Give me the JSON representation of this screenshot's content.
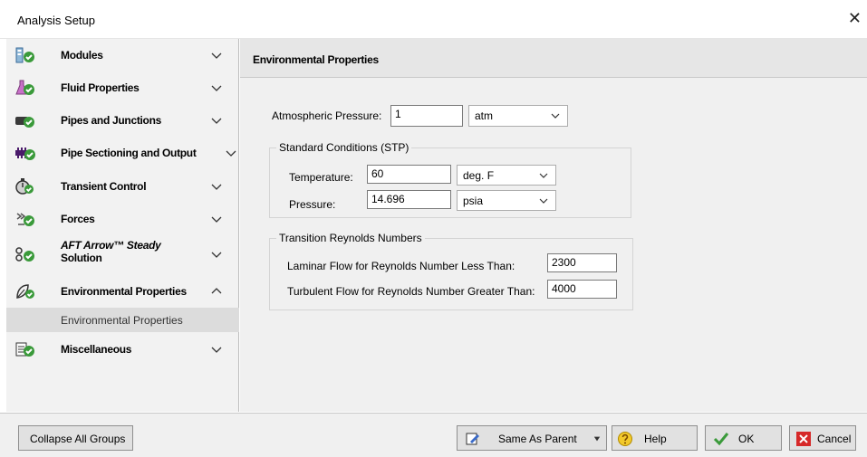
{
  "window": {
    "title": "Analysis Setup",
    "close_glyph": "✕"
  },
  "sidebar": {
    "items": [
      {
        "label": "Modules",
        "icon": "modules-icon",
        "chevron": "down"
      },
      {
        "label": "Fluid Properties",
        "icon": "fluid-flask-icon",
        "chevron": "down"
      },
      {
        "label": "Pipes and Junctions",
        "icon": "pipe-icon",
        "chevron": "down"
      },
      {
        "label": "Pipe Sectioning and Output",
        "icon": "pipe-sectioning-icon",
        "chevron": "down"
      },
      {
        "label": "Transient Control",
        "icon": "stopwatch-icon",
        "chevron": "down"
      },
      {
        "label": "Forces",
        "icon": "forces-icon",
        "chevron": "down"
      },
      {
        "label": "AFT Arrow™ Steady Solution",
        "label_brand": "AFT Arrow™ Steady",
        "label_line2": "Solution",
        "icon": "steady-solution-icon",
        "chevron": "down"
      },
      {
        "label": "Environmental Properties",
        "icon": "leaf-icon",
        "chevron": "up"
      },
      {
        "label": "Miscellaneous",
        "icon": "miscellaneous-icon",
        "chevron": "down"
      }
    ],
    "sub_item": "Environmental Properties"
  },
  "content": {
    "header": "Environmental Properties",
    "atmospheric_pressure": {
      "label": "Atmospheric Pressure:",
      "value": "1",
      "unit": "atm"
    },
    "stp": {
      "legend": "Standard Conditions (STP)",
      "temperature": {
        "label": "Temperature:",
        "value": "60",
        "unit": "deg. F"
      },
      "pressure": {
        "label": "Pressure:",
        "value": "14.696",
        "unit": "psia"
      }
    },
    "reynolds": {
      "legend": "Transition Reynolds Numbers",
      "laminar": {
        "label": "Laminar Flow for Reynolds Number Less Than:",
        "value": "2300"
      },
      "turbulent": {
        "label": "Turbulent Flow for Reynolds Number Greater Than:",
        "value": "4000"
      }
    }
  },
  "footer": {
    "collapse": "Collapse All Groups",
    "same_as_parent": "Same As Parent",
    "help": "Help",
    "ok": "OK",
    "cancel": "Cancel"
  },
  "colors": {
    "check_green": "#3a9a3a",
    "cancel_red": "#d62828",
    "sub_item_bg": "#dcdcdc"
  }
}
